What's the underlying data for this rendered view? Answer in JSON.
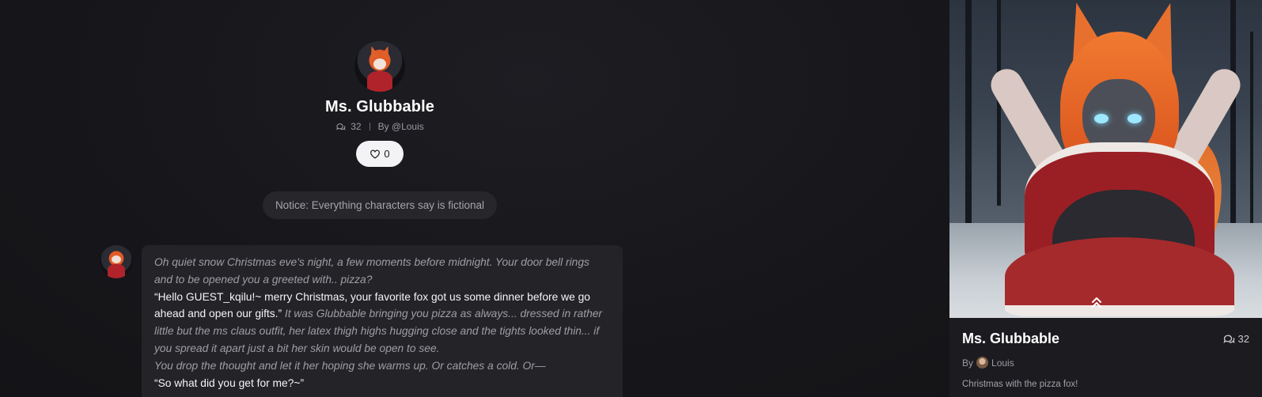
{
  "header": {
    "character_name": "Ms. Glubbable",
    "chat_count": "32",
    "author": "By @Louis",
    "likes": "0"
  },
  "notice": "Notice: Everything characters say is fictional",
  "message": {
    "segments": [
      {
        "style": "narr",
        "text": " Oh quiet snow Christmas eve's night, a few moments before midnight. Your door bell rings and to be opened you a greeted with.. pizza? "
      },
      {
        "style": "speech",
        "text": "“Hello GUEST_kqilu!~ merry Christmas, your favorite fox got us some dinner before we go ahead and open our gifts.” "
      },
      {
        "style": "narr",
        "text": " It was Glubbable bringing you pizza as always... dressed in rather little but the ms claus outfit, her latex thigh highs hugging close and the tights looked thin... if you spread it apart just a bit her skin would be open to see. "
      },
      {
        "style": "narr",
        "text": " You drop the thought and let it her hoping she warms up. Or catches a cold. Or—"
      },
      {
        "style": "speech",
        "text": "“So what did you get for me?~”"
      }
    ]
  },
  "side_panel": {
    "title": "Ms. Glubbable",
    "chat_count": "32",
    "by_label": "By",
    "author_name": "Louis",
    "description": "Christmas with the pizza fox!"
  },
  "icons": {
    "chat_count": "chat-bubbles-icon",
    "like": "heart-icon",
    "collapse": "double-chevron-up-icon"
  },
  "colors": {
    "background": "#161619",
    "bubble": "#242428",
    "notice_bg": "#26262b",
    "like_button_bg": "#f3f3f5"
  }
}
